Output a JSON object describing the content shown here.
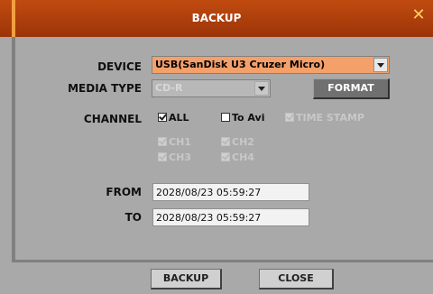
{
  "dialog": {
    "title": "BACKUP",
    "close_glyph": "✕"
  },
  "device": {
    "label": "DEVICE",
    "value": "USB(SanDisk U3 Cruzer Micro)"
  },
  "media_type": {
    "label": "MEDIA TYPE",
    "value": "CD-R",
    "format_label": "FORMAT"
  },
  "channel": {
    "label": "CHANNEL",
    "all_label": "ALL",
    "to_avi_label": "To Avi",
    "time_stamp_label": "TIME STAMP",
    "channels": [
      {
        "label": "CH1",
        "checked": true
      },
      {
        "label": "CH2",
        "checked": true
      },
      {
        "label": "CH3",
        "checked": true
      },
      {
        "label": "CH4",
        "checked": true
      }
    ]
  },
  "from": {
    "label": "FROM",
    "value": "2028/08/23 05:59:27"
  },
  "to": {
    "label": "TO",
    "value": "2028/08/23 05:59:27"
  },
  "footer": {
    "backup_label": "BACKUP",
    "close_label": "CLOSE"
  },
  "colors": {
    "title_bar": "#b0400c",
    "device_select": "#f4a06a",
    "panel": "#a9a9a9"
  }
}
